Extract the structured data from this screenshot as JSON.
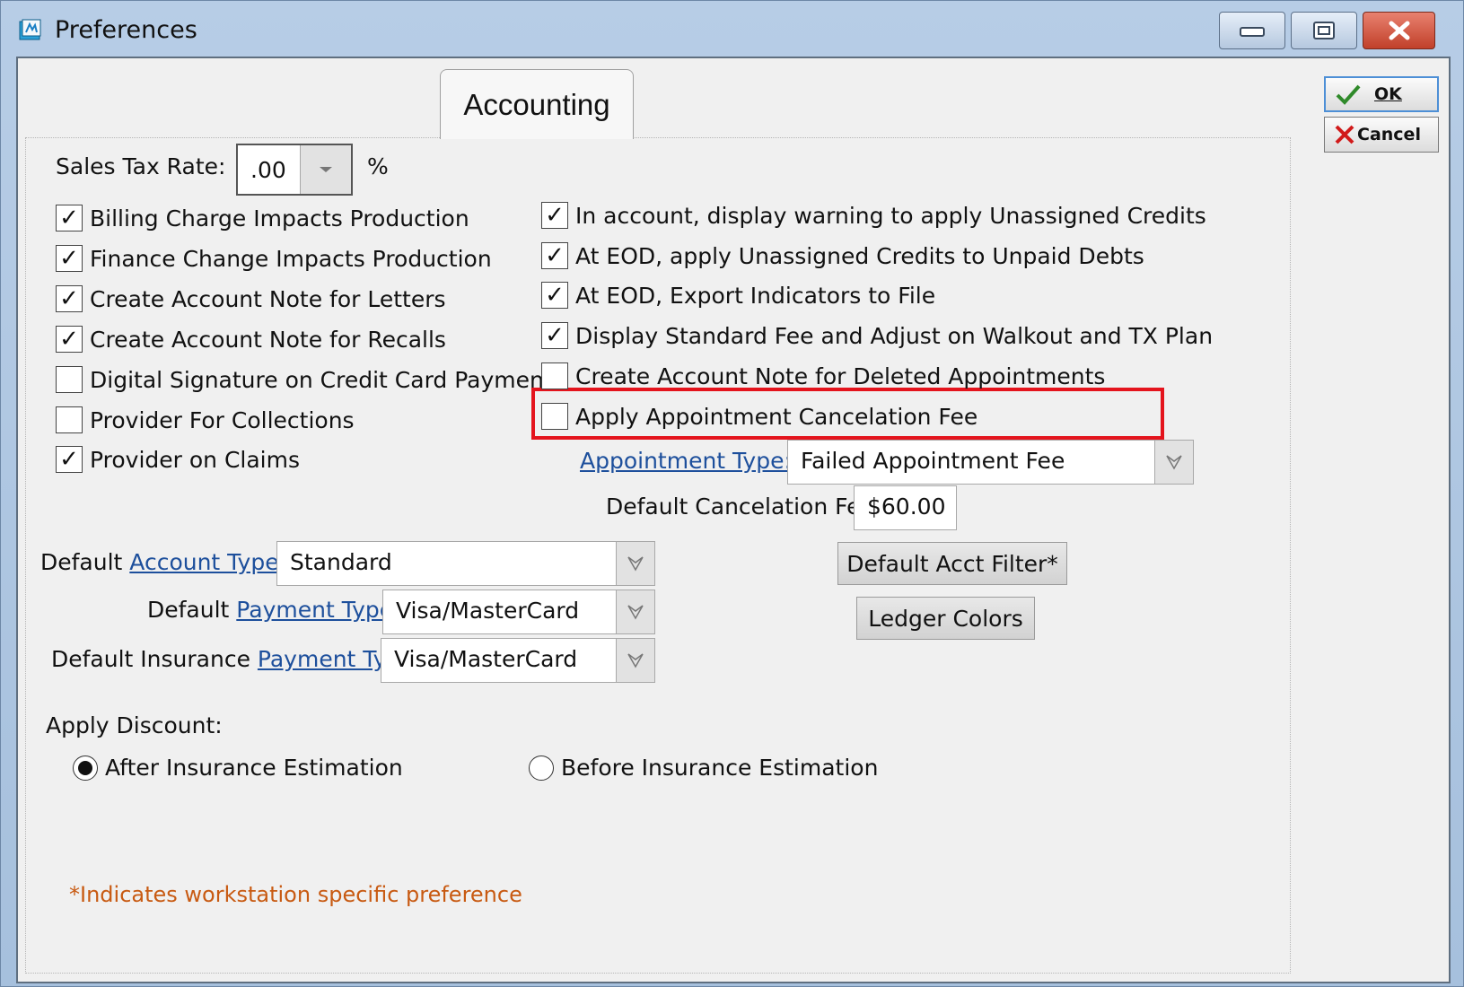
{
  "window": {
    "title": "Preferences",
    "controls": {
      "minimize_icon": "minimize-icon",
      "maximize_icon": "maximize-icon",
      "close_icon": "close-icon"
    }
  },
  "tab": {
    "label": "Accounting"
  },
  "buttons": {
    "ok": "OK",
    "cancel": "Cancel"
  },
  "sales_tax": {
    "label": "Sales Tax Rate:",
    "value": ".00",
    "unit": "%"
  },
  "left_checks": [
    {
      "label": "Billing Charge Impacts Production",
      "checked": true
    },
    {
      "label": "Finance Change Impacts Production",
      "checked": true
    },
    {
      "label": "Create Account Note for Letters",
      "checked": true
    },
    {
      "label": "Create Account Note for Recalls",
      "checked": true
    },
    {
      "label": "Digital Signature on Credit Card Payment",
      "checked": false
    },
    {
      "label": "Provider For Collections",
      "checked": false
    },
    {
      "label": "Provider on Claims",
      "checked": true
    }
  ],
  "right_checks": [
    {
      "label": "In account, display warning to apply Unassigned Credits",
      "checked": true
    },
    {
      "label": "At EOD, apply Unassigned Credits to Unpaid Debts",
      "checked": true
    },
    {
      "label": "At EOD, Export Indicators to File",
      "checked": true
    },
    {
      "label": "Display Standard Fee and Adjust on Walkout and TX Plan",
      "checked": true
    },
    {
      "label": "Create Account Note for Deleted Appointments",
      "checked": false
    },
    {
      "label": "Apply Appointment Cancelation Fee",
      "checked": false
    }
  ],
  "appointment_type": {
    "label": "Appointment Type:",
    "value": "Failed Appointment Fee"
  },
  "cancel_fee": {
    "label": "Default Cancelation Fee:",
    "value": "$60.00"
  },
  "default_acct_filter": "Default Acct Filter*",
  "ledger_colors": "Ledger Colors",
  "account_type": {
    "prefix": "Default ",
    "link": "Account Type",
    "value": "Standard"
  },
  "payment_type": {
    "prefix": "Default ",
    "link": "Payment Type",
    "value": "Visa/MasterCard"
  },
  "insurance_payment_type": {
    "prefix": "Default Insurance ",
    "link": "Payment Type",
    "value": "Visa/MasterCard"
  },
  "discount": {
    "label": "Apply Discount:",
    "options": [
      {
        "label": "After Insurance Estimation",
        "selected": true
      },
      {
        "label": "Before Insurance Estimation",
        "selected": false
      }
    ]
  },
  "footnote": "*Indicates workstation specific preference",
  "colors": {
    "highlight": "#e4141d",
    "link": "#1d4f9c",
    "footnote": "#c85a12"
  }
}
